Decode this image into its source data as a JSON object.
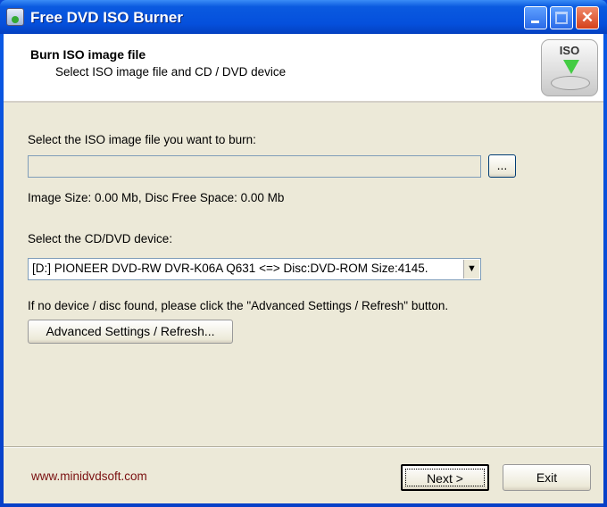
{
  "window": {
    "title": "Free DVD ISO Burner"
  },
  "header": {
    "title": "Burn ISO image file",
    "subtitle": "Select ISO image file and CD / DVD device",
    "icon_label": "ISO"
  },
  "iso": {
    "label": "Select the ISO image file you want to burn:",
    "value": "",
    "browse_label": "...",
    "size_info": "Image Size: 0.00 Mb, Disc Free Space: 0.00 Mb"
  },
  "device": {
    "label": "Select the CD/DVD device:",
    "selected": "[D:] PIONEER DVD-RW  DVR-K06A Q631  <=> Disc:DVD-ROM  Size:4145.",
    "hint": "If no device / disc found, please click the \"Advanced Settings / Refresh\" button.",
    "advanced_label": "Advanced Settings / Refresh..."
  },
  "footer": {
    "website": "www.minidvdsoft.com",
    "next_label": "Next >",
    "exit_label": "Exit"
  }
}
